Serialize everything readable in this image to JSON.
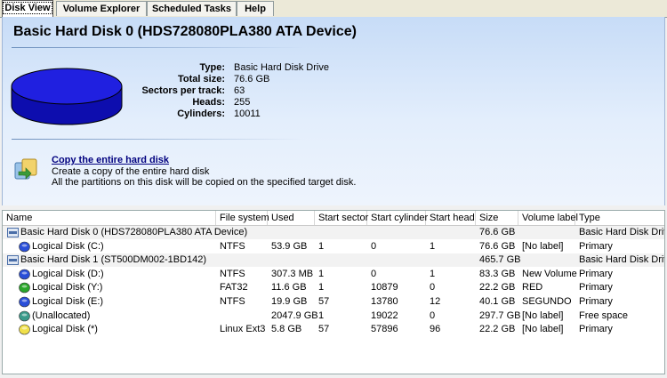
{
  "tabs": [
    "Disk View",
    "Volume Explorer",
    "Scheduled Tasks",
    "Help"
  ],
  "disk": {
    "title": "Basic Hard Disk 0 (HDS728080PLA380 ATA Device)",
    "properties": [
      {
        "label": "Type:",
        "value": "Basic Hard Disk Drive"
      },
      {
        "label": "Total size:",
        "value": "76.6 GB"
      },
      {
        "label": "Sectors per track:",
        "value": "63"
      },
      {
        "label": "Heads:",
        "value": "255"
      },
      {
        "label": "Cylinders:",
        "value": "10011"
      }
    ]
  },
  "action": {
    "link": "Copy the entire hard disk",
    "desc1": "Create a copy of the entire hard disk",
    "desc2": "All the partitions on this disk will be copied on the specified target disk."
  },
  "table": {
    "columns": [
      "Name",
      "File system",
      "Used",
      "Start sector",
      "Start cylinder",
      "Start head",
      "Size",
      "Volume label",
      "Type"
    ],
    "rows": [
      {
        "kind": "disk",
        "icon": "disk",
        "name": "Basic Hard Disk 0 (HDS728080PLA380 ATA Device)",
        "fs": "",
        "used": "",
        "sector": "",
        "cyl": "",
        "head": "",
        "size": "76.6 GB",
        "label": "",
        "type": "Basic Hard Disk Drive"
      },
      {
        "kind": "part",
        "icon": "blue",
        "name": "Logical Disk (C:)",
        "fs": "NTFS",
        "used": "53.9 GB",
        "sector": "1",
        "cyl": "0",
        "head": "1",
        "size": "76.6 GB",
        "label": "[No label]",
        "type": "Primary"
      },
      {
        "kind": "disk",
        "icon": "disk",
        "name": "Basic Hard Disk 1 (ST500DM002-1BD142)",
        "fs": "",
        "used": "",
        "sector": "",
        "cyl": "",
        "head": "",
        "size": "465.7 GB",
        "label": "",
        "type": "Basic Hard Disk Drive"
      },
      {
        "kind": "part",
        "icon": "blue",
        "name": "Logical Disk (D:)",
        "fs": "NTFS",
        "used": "307.3 MB",
        "sector": "1",
        "cyl": "0",
        "head": "1",
        "size": "83.3 GB",
        "label": "New Volume",
        "type": "Primary"
      },
      {
        "kind": "part",
        "icon": "green",
        "name": "Logical Disk (Y:)",
        "fs": "FAT32",
        "used": "11.6 GB",
        "sector": "1",
        "cyl": "10879",
        "head": "0",
        "size": "22.2 GB",
        "label": "RED",
        "type": "Primary"
      },
      {
        "kind": "part",
        "icon": "blue",
        "name": "Logical Disk (E:)",
        "fs": "NTFS",
        "used": "19.9 GB",
        "sector": "57",
        "cyl": "13780",
        "head": "12",
        "size": "40.1 GB",
        "label": "SEGUNDO",
        "type": "Primary"
      },
      {
        "kind": "part",
        "icon": "teal",
        "name": "(Unallocated)",
        "fs": "",
        "used": "2047.9 GB",
        "sector": "1",
        "cyl": "19022",
        "head": "0",
        "size": "297.7 GB",
        "label": "[No label]",
        "type": "Free space"
      },
      {
        "kind": "part",
        "icon": "yellow",
        "name": "Logical Disk (*)",
        "fs": "Linux Ext3",
        "used": "5.8 GB",
        "sector": "57",
        "cyl": "57896",
        "head": "96",
        "size": "22.2 GB",
        "label": "[No label]",
        "type": "Primary"
      }
    ]
  },
  "colors": {
    "disk_graphic": "#1a1ad6",
    "link": "#00007f"
  }
}
